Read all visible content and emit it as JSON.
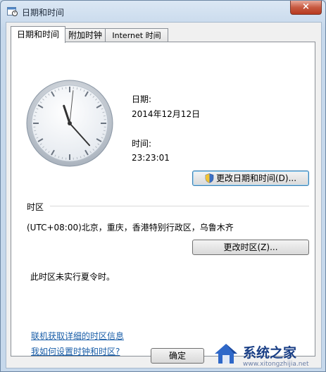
{
  "window": {
    "title": "日期和时间",
    "close_glyph": "×"
  },
  "tabs": [
    {
      "label": "日期和时间",
      "active": true
    },
    {
      "label": "附加时钟",
      "active": false
    },
    {
      "label": "Internet 时间",
      "active": false
    }
  ],
  "clock": {
    "hour": 23,
    "minute": 23,
    "second": 1
  },
  "date": {
    "label": "日期:",
    "value": "2014年12月12日"
  },
  "time": {
    "label": "时间:",
    "value": "23:23:01"
  },
  "buttons": {
    "change_datetime": "更改日期和时间(D)...",
    "change_timezone": "更改时区(Z)...",
    "ok": "确定"
  },
  "timezone": {
    "heading": "时区",
    "value": "(UTC+08:00)北京，重庆，香港特别行政区，乌鲁木齐",
    "dst_note": "此时区未实行夏令时。"
  },
  "links": {
    "online_info": "联机获取详细的时区信息",
    "how_to": "我如何设置时钟和时区?"
  },
  "watermark": {
    "text": "系统之家",
    "url": "www.xitongzhijia.net"
  },
  "colors": {
    "link": "#1a5ea8",
    "window_frame": "#c6d8eb",
    "close_button": "#c75a41"
  }
}
